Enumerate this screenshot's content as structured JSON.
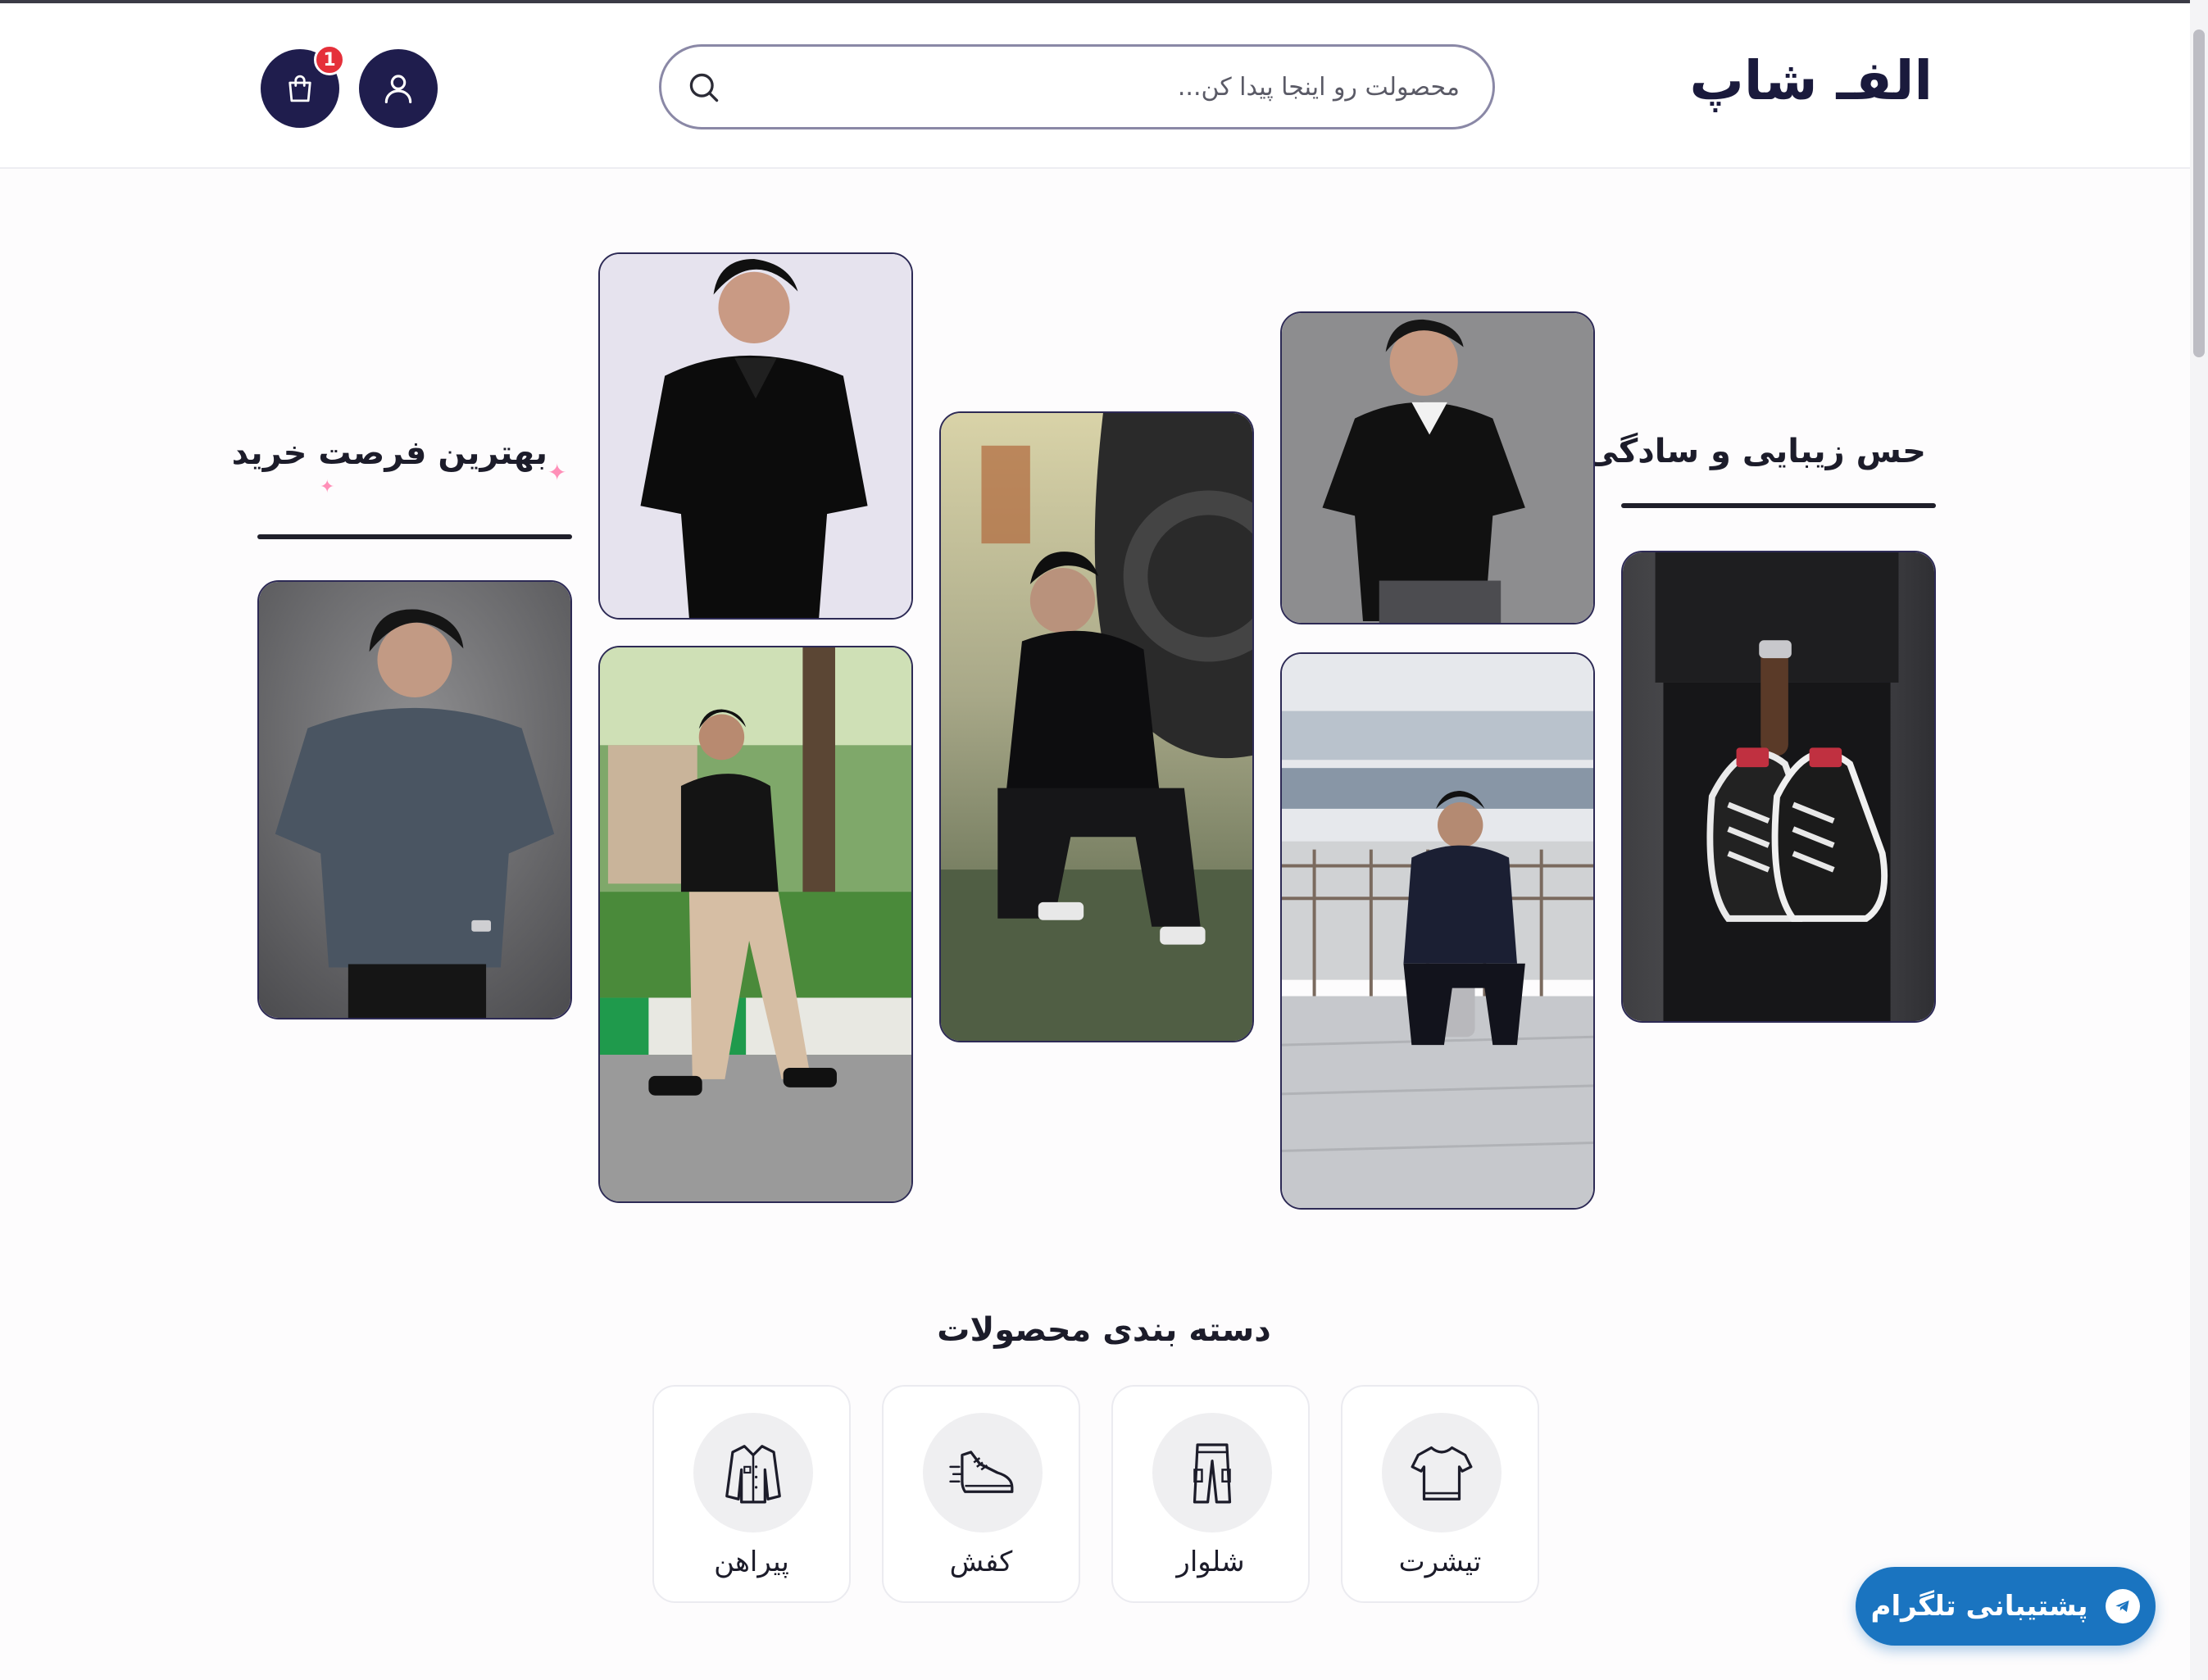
{
  "header": {
    "logo_text": "الفـ شاپ",
    "search": {
      "placeholder": "محصولت رو اینجا پیدا کن...",
      "value": ""
    },
    "cart": {
      "badge_count": "1"
    }
  },
  "hero": {
    "title_right": "حس زیبایی و سادگی",
    "title_left": "بهترین فرصت خرید"
  },
  "categories": {
    "title": "دسته بندی محصولات",
    "items": [
      {
        "label": "تیشرت",
        "icon": "tshirt-icon"
      },
      {
        "label": "شلوار",
        "icon": "pants-icon"
      },
      {
        "label": "کفش",
        "icon": "shoe-icon"
      },
      {
        "label": "پیراهن",
        "icon": "shirt-icon"
      }
    ]
  },
  "support": {
    "telegram_label": "پشتیبانی تلگرام"
  },
  "colors": {
    "primary": "#1f1d4d",
    "badge": "#e5303a",
    "telegram": "#1a74c0",
    "card_border": "#2d2a55"
  }
}
